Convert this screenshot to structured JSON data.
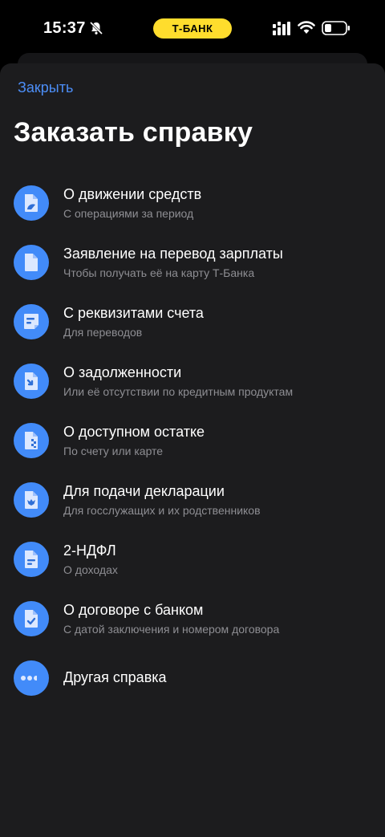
{
  "status_bar": {
    "time": "15:37",
    "bank_label": "Т-БАНК"
  },
  "sheet": {
    "close_label": "Закрыть",
    "title": "Заказать справку"
  },
  "items": [
    {
      "title": "О движении средств",
      "subtitle": "С операциями за период",
      "icon": "document-chart-icon"
    },
    {
      "title": "Заявление на перевод зарплаты",
      "subtitle": "Чтобы получать её на карту Т-Банка",
      "icon": "document-icon"
    },
    {
      "title": "С реквизитами счета",
      "subtitle": "Для переводов",
      "icon": "requisites-icon"
    },
    {
      "title": "О задолженности",
      "subtitle": "Или её отсутствии по кредитным продуктам",
      "icon": "document-arrow-icon"
    },
    {
      "title": "О доступном остатке",
      "subtitle": "По счету или карте",
      "icon": "document-balance-icon"
    },
    {
      "title": "Для подачи декларации",
      "subtitle": "Для госслужащих и их родственников",
      "icon": "document-emblem-icon"
    },
    {
      "title": "2-НДФЛ",
      "subtitle": "О доходах",
      "icon": "document-lines-icon"
    },
    {
      "title": "О договоре с банком",
      "subtitle": "С датой заключения и номером договора",
      "icon": "document-check-icon"
    },
    {
      "title": "Другая справка",
      "subtitle": "",
      "icon": "more-dots-icon"
    }
  ],
  "colors": {
    "accent": "#4C8EF7",
    "icon_bg": "#428BF9",
    "brand_yellow": "#FFDD2D",
    "sheet_bg": "#1C1C1E",
    "subtitle": "#8E8E93"
  }
}
